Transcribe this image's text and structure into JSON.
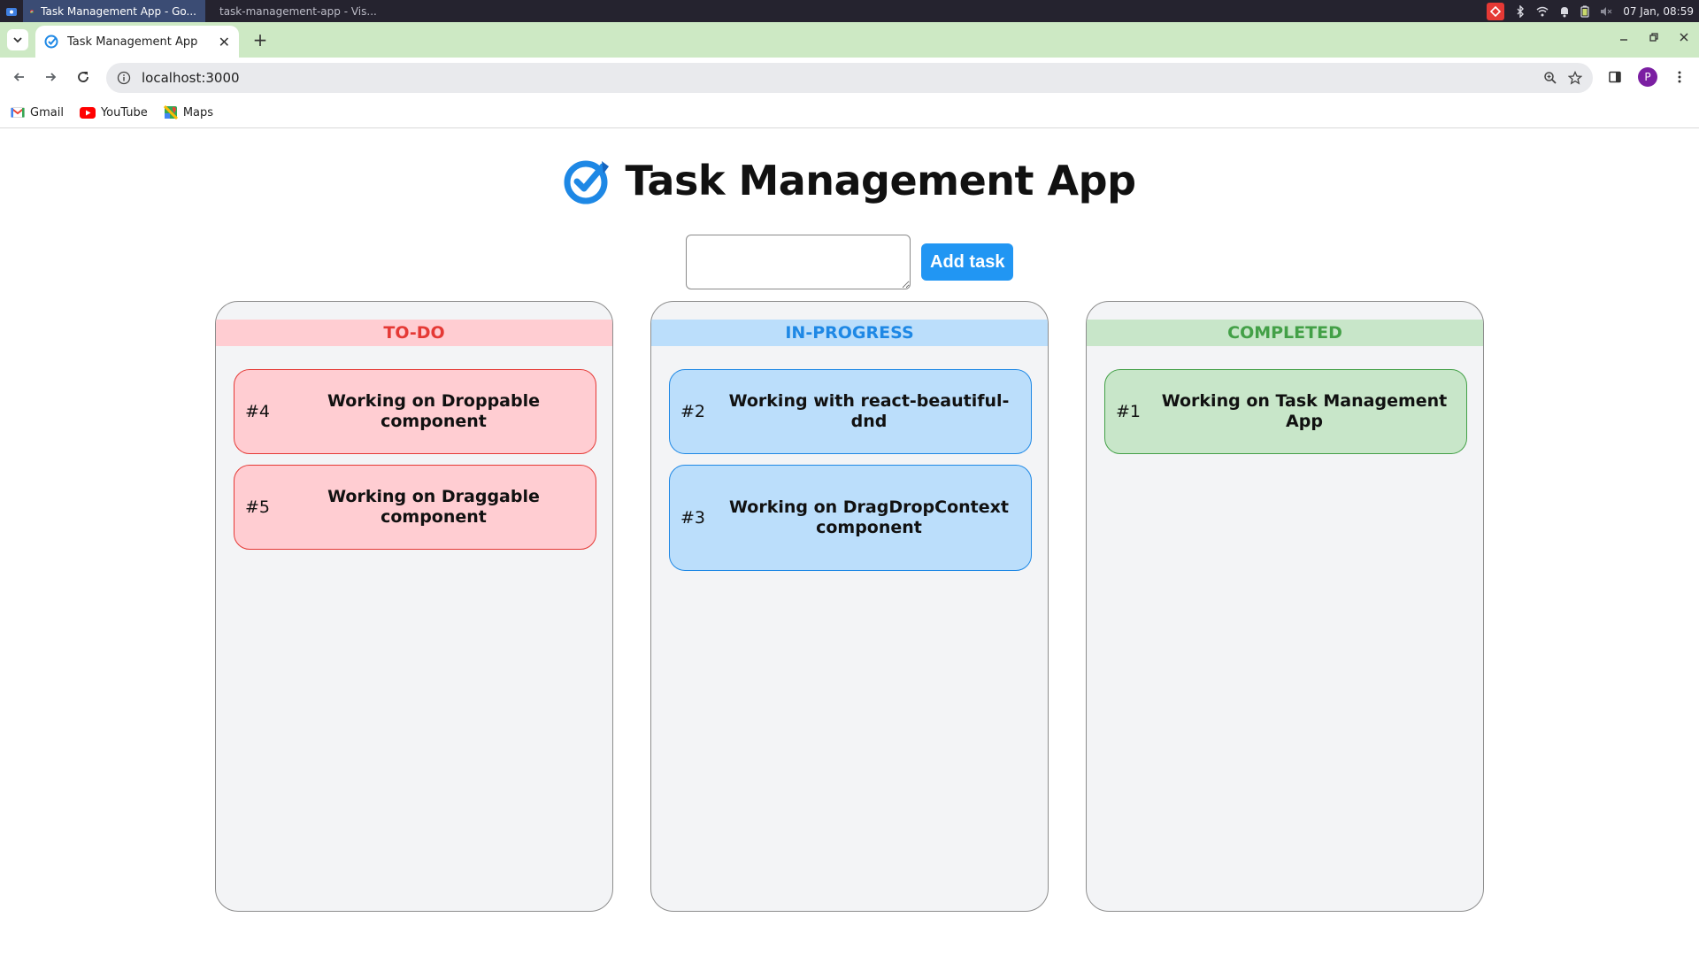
{
  "os": {
    "tasks": [
      {
        "label": "Task Management App - Go..."
      },
      {
        "label": "task-management-app - Vis..."
      }
    ],
    "clock": "07 Jan, 08:59"
  },
  "browser": {
    "tab_title": "Task Management App",
    "url": "localhost:3000",
    "bookmarks": [
      {
        "label": "Gmail"
      },
      {
        "label": "YouTube"
      },
      {
        "label": "Maps"
      }
    ],
    "profile_initial": "P"
  },
  "app": {
    "title": "Task Management App",
    "input": {
      "value": "",
      "placeholder": ""
    },
    "add_button": "Add task",
    "columns": [
      {
        "title": "TO-DO",
        "color": "#e53935",
        "tasks": [
          {
            "id": "#4",
            "text": "Working on Droppable component"
          },
          {
            "id": "#5",
            "text": "Working on Draggable component"
          }
        ]
      },
      {
        "title": "IN-PROGRESS",
        "color": "#1e88e5",
        "tasks": [
          {
            "id": "#2",
            "text": "Working with react-beautiful-dnd"
          },
          {
            "id": "#3",
            "text": "Working on DragDropContext component"
          }
        ]
      },
      {
        "title": "COMPLETED",
        "color": "#43a047",
        "tasks": [
          {
            "id": "#1",
            "text": "Working on Task Management App"
          }
        ]
      }
    ]
  }
}
